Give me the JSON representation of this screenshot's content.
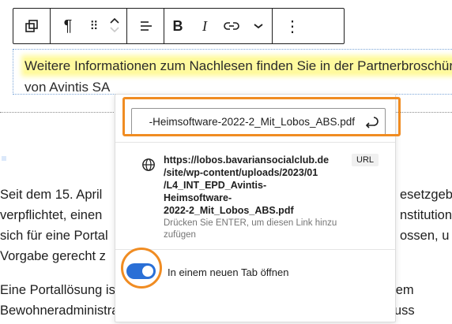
{
  "toolbar": {
    "transform_icon": "block-transform-icon",
    "paragraph_icon": "¶",
    "drag_icon": "⠿",
    "align_icon": "align-left-icon",
    "bold": "B",
    "italic": "I",
    "link_icon": "link-icon",
    "more_icon": "chevron-down-icon",
    "options_icon": "⋮"
  },
  "content": {
    "fragment": "al",
    "para1_line1": "Weitere Informationen zum Nachlesen finden Sie in der Partnerbroschüre",
    "para1_line2": "von Avintis SA",
    "lines": [
      "Seit dem 15. April",
      "verpflichtet, einen",
      "sich für eine Portal",
      "Vorgabe gerecht z",
      "Eine Portallösung ist losgelöst vom Primärsystem (das heisst von Ihrem",
      "Bewohneradministrations- und Pflegedokumentationssystem) und muss"
    ],
    "right_fragments": [
      "esetzgeb",
      "nstitution",
      "ossen, u"
    ]
  },
  "link_popover": {
    "input_value": "-Heimsoftware-2022-2_Mit_Lobos_ABS.pdf",
    "suggestion_url": "https://lobos.bavariansocialclub.de/site/wp-content/uploads/2023/01/L4_INT_EPD_Avintis-Heimsoftware-2022-2_Mit_Lobos_ABS.pdf",
    "suggestion_url_lines": [
      "https://lobos.bavariansocialclub.de",
      "/site/wp-content/uploads/2023/01",
      "/L4_INT_EPD_Avintis-",
      "Heimsoftware-",
      "2022-2_Mit_Lobos_ABS.pdf"
    ],
    "suggestion_hint": "Drücken Sie ENTER, um diesen Link hinzu zufügen",
    "badge": "URL",
    "toggle_label": "In einem neuen Tab öffnen",
    "toggle_on": true
  },
  "colors": {
    "accent": "#2a6fd6",
    "highlight": "#f08c22",
    "text_highlight": "#fffa9e"
  }
}
